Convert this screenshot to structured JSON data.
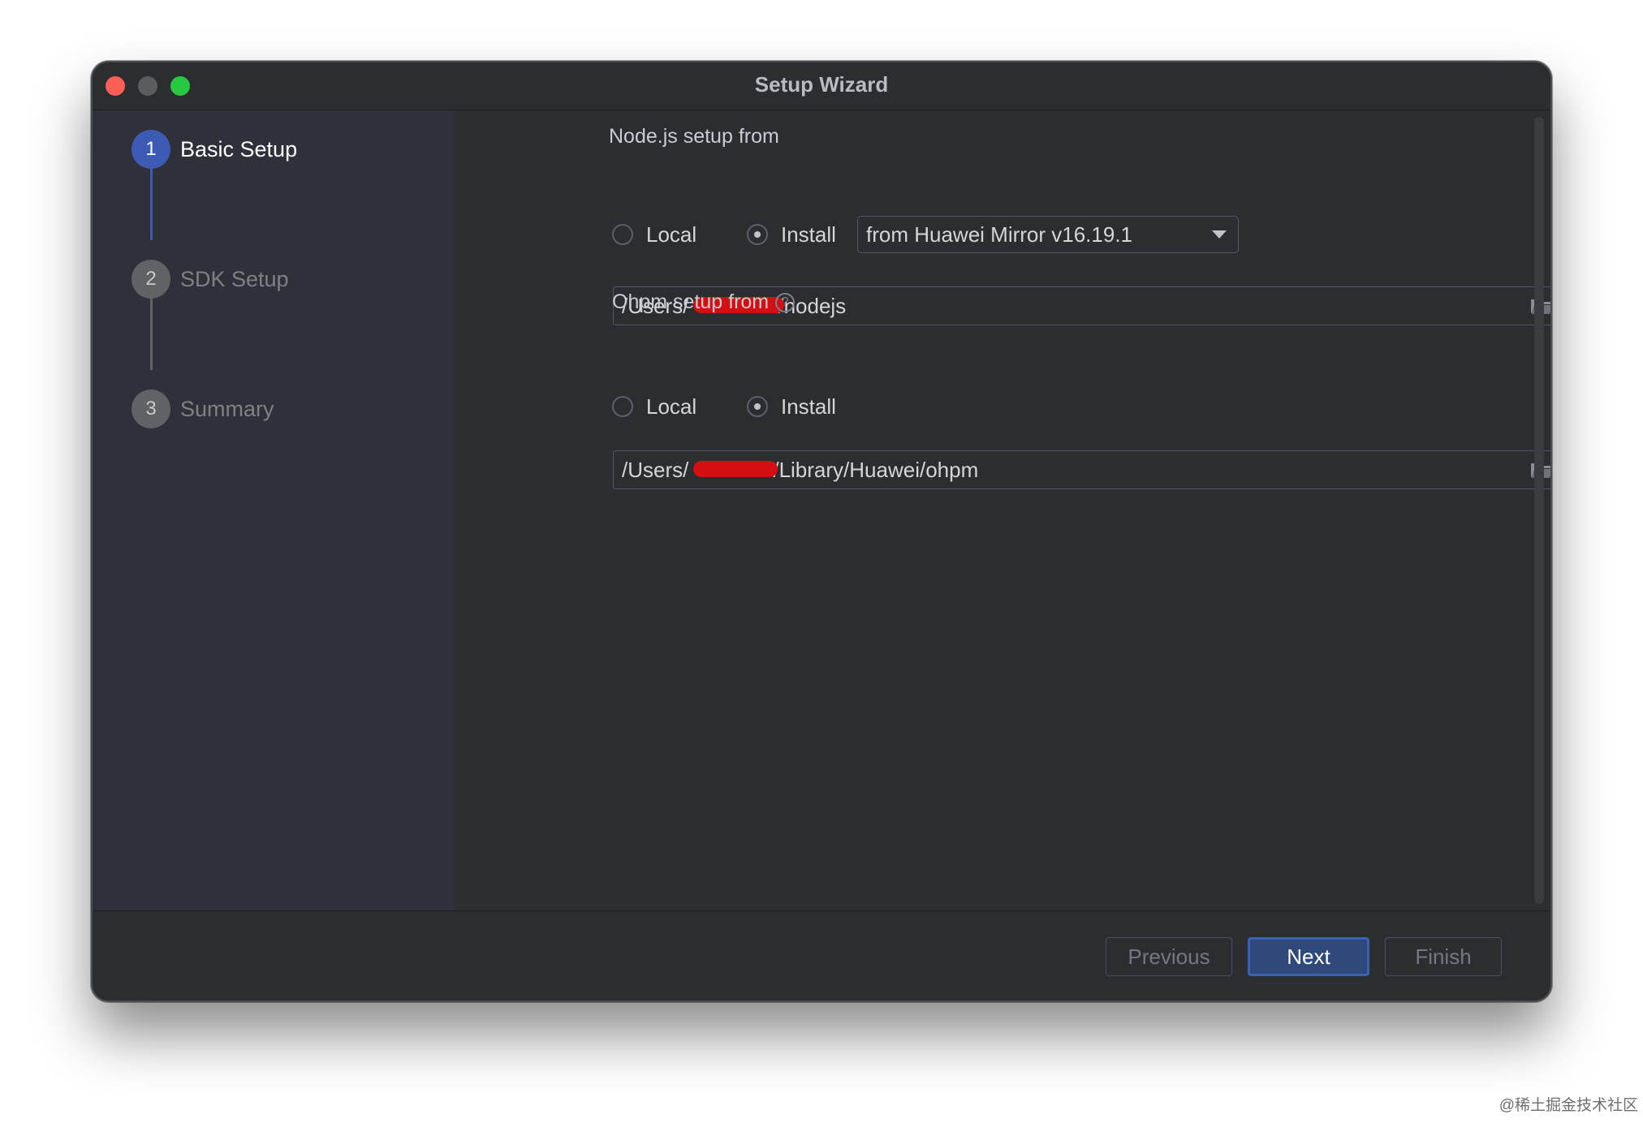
{
  "window": {
    "title": "Setup Wizard"
  },
  "sidebar": {
    "steps": [
      {
        "number": "1",
        "label": "Basic Setup",
        "state": "active"
      },
      {
        "number": "2",
        "label": "SDK Setup",
        "state": "inactive"
      },
      {
        "number": "3",
        "label": "Summary",
        "state": "inactive"
      }
    ]
  },
  "nodejs": {
    "section_label": "Node.js setup from",
    "option_local": "Local",
    "option_install": "Install",
    "selected": "Install",
    "mirror_select": "from Huawei Mirror v16.19.1",
    "path_prefix": "/Users/",
    "path_suffix": "/nodejs"
  },
  "ohpm": {
    "section_label": "Ohpm setup from",
    "help_glyph": "?",
    "option_local": "Local",
    "option_install": "Install",
    "selected": "Install",
    "path_prefix": "/Users/",
    "path_suffix": "/Library/Huawei/ohpm"
  },
  "footer": {
    "previous_label": "Previous",
    "next_label": "Next",
    "finish_label": "Finish"
  },
  "watermark": "@稀土掘金技术社区",
  "colors": {
    "accent": "#3d5bb5",
    "close": "#ff5f57",
    "maximize": "#28c840",
    "redaction": "#d40f14"
  }
}
